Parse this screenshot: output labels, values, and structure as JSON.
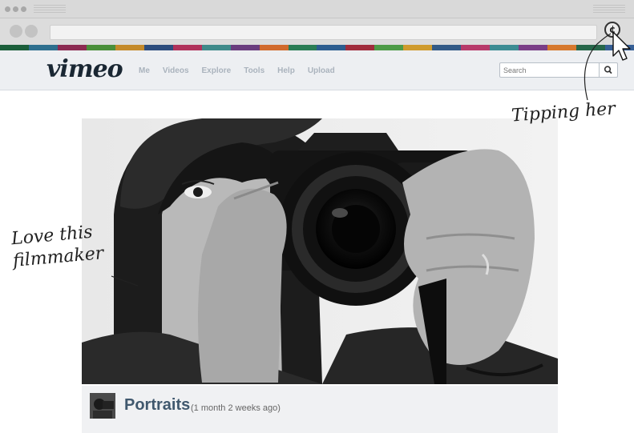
{
  "browser": {
    "tip_icon_glyph": "¢",
    "color_band": [
      "#1b5e3a",
      "#2e6f8e",
      "#8c2b52",
      "#4a8f3a",
      "#c48a2a",
      "#2d4d7d",
      "#b0325b",
      "#3f8a8a",
      "#6a3d7e",
      "#d16a2c",
      "#2a7d55",
      "#2c5d8f",
      "#a02c3c",
      "#4d9b47",
      "#cf9b2e",
      "#335a86",
      "#b73a6a",
      "#3c8c93",
      "#7a3e86",
      "#d6782d",
      "#27674a",
      "#365f95"
    ]
  },
  "header": {
    "logo": "vimeo",
    "nav": [
      {
        "label": "Me"
      },
      {
        "label": "Videos"
      },
      {
        "label": "Explore"
      },
      {
        "label": "Tools"
      },
      {
        "label": "Help"
      },
      {
        "label": "Upload"
      }
    ],
    "search": {
      "placeholder": "Search",
      "icon": "search-icon"
    }
  },
  "video": {
    "title": "Portraits",
    "meta": "(1 month 2 weeks ago)",
    "subject": "woman holding a camera to her eye",
    "thumbnail": "portrait-thumbnail"
  },
  "annotations": {
    "tip": "Tipping her",
    "love_line1": "Love this",
    "love_line2": "filmmaker"
  }
}
